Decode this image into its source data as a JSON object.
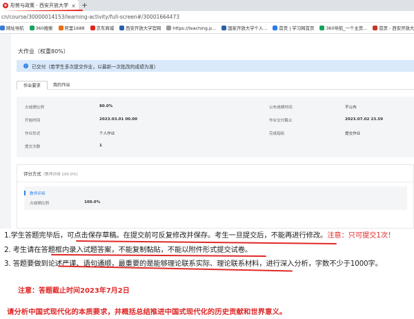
{
  "browser": {
    "tab_title": "形势与政策 - 西安开放大学",
    "tab_close": "×",
    "new_tab": "+",
    "address": "cn/course/30000014153/learning-activity/full-screen#/30001664473",
    "bookmarks": [
      {
        "label": "网址导航",
        "color": "#3a7bd5"
      },
      {
        "label": "360搜索",
        "color": "#1aa260"
      },
      {
        "label": "阿里1688",
        "color": "#f06a0f"
      },
      {
        "label": "京东商城",
        "color": "#e1251b"
      },
      {
        "label": "西安开放大学官网",
        "color": "#2b5fa8"
      },
      {
        "label": "https://teaching.p...",
        "color": "#999999"
      },
      {
        "label": "国家开放大学个人...",
        "color": "#2b5fa8"
      },
      {
        "label": "首页 | 学习网首页",
        "color": "#2b7de9"
      },
      {
        "label": "360导航_一个主页...",
        "color": "#1aa260"
      },
      {
        "label": "首页 - 西安开放大学...",
        "color": "#c0392b"
      }
    ]
  },
  "page": {
    "title": "大作业（权重80%）",
    "notice_icon": "i",
    "notice": "已交付（若学生多次提交作业，以最新一次批改的成绩为准）",
    "tabs": [
      "作业要求",
      "我的作业"
    ],
    "info": {
      "score_ratio_label": "占成绩比例",
      "score_ratio": "80.0%",
      "publish_label": "公布成绩时间",
      "publish": "不公布",
      "start_label": "开始时间",
      "start": "2023.03.01 00.00",
      "deadline_label": "作业交付截止",
      "deadline": "2023.07.02 23.59",
      "form_label": "作业形式",
      "form": "个人作业",
      "complete_label": "完成指标",
      "complete": "提交作业",
      "submit_count_label": "提交次数",
      "submit_count": "1"
    },
    "scoring": {
      "method_label": "评分方式",
      "method_detail": "（教师评阅 100.0%）",
      "teacher_label": "教师评阅",
      "ratio_label": "占成绩比例",
      "ratio": "100.0%"
    }
  },
  "notes": {
    "line1_a": "1.学生答题完毕后，可点击保存草稿。在提交前可反复修改并保存。考生一旦提交后，不能再进行修改。",
    "line1_b": "注意：只可提交1次！",
    "line2": "2. 考生请在答题框内录入试题答案，不能复制黏贴，不能以附件形式提交试卷。",
    "line3": "3. 答题要做到论述严谨、语句通顺，最重要的是能够理论联系实际、理论联系材料，进行深入分析，字数不少于1000字。",
    "deadline": "注意：答题截止时间2023年7月2日",
    "question": "请分析中国式现代化的本质要求，并概括总结推进中国式现代化的历史贡献和世界意义。"
  },
  "colors": {
    "accent": "#2f82e5",
    "warning": "#e02828",
    "notice_bg": "#d9e9fb"
  }
}
